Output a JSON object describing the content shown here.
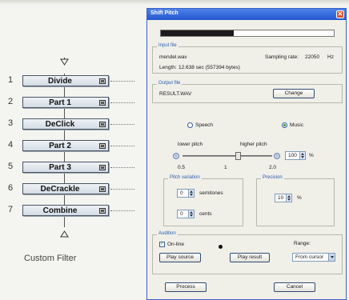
{
  "filter_chain": {
    "items": [
      {
        "num": "1",
        "label": "Divide"
      },
      {
        "num": "2",
        "label": "Part 1"
      },
      {
        "num": "3",
        "label": "DeClick"
      },
      {
        "num": "4",
        "label": "Part 2"
      },
      {
        "num": "5",
        "label": "Part 3"
      },
      {
        "num": "6",
        "label": "DeCrackle"
      },
      {
        "num": "7",
        "label": "Combine"
      }
    ],
    "caption": "Custom Filter"
  },
  "dialog": {
    "title": "Shift Pitch",
    "close_glyph": "✕",
    "progress": 0.42,
    "input_file": {
      "group_title": "Input file",
      "filename": "mendel.wav",
      "sampling_rate_label": "Sampling rate:",
      "sampling_rate_value": "22050",
      "sampling_rate_unit": "Hz",
      "length_label": "Length:",
      "length_value": "12.638 sec (557394 bytes)"
    },
    "output_file": {
      "group_title": "Output file",
      "filename": "RESULT.WAV",
      "change_button": "Change"
    },
    "mode": {
      "speech_label": "Speech",
      "music_label": "Music",
      "selected": "Music"
    },
    "pitch_slider": {
      "lower_label": "lower pitch",
      "higher_label": "higher pitch",
      "tick_min": "0.5",
      "tick_mid": "1",
      "tick_max": "2.0",
      "value": "100",
      "unit": "%",
      "position": 0.62
    },
    "pitch_variation": {
      "group_title": "Pitch variation",
      "semitones_value": "0",
      "semitones_label": "semitones",
      "cents_value": "0",
      "cents_label": "cents"
    },
    "precision": {
      "group_title": "Precision",
      "value": "10",
      "unit": "%"
    },
    "audition": {
      "group_title": "Audition",
      "online_label": "On-line",
      "online_checked": true,
      "range_label": "Range:",
      "range_value": "From cursor",
      "play_source_button": "Play source",
      "play_result_button": "Play result"
    },
    "process_button": "Process",
    "cancel_button": "Cancel"
  }
}
